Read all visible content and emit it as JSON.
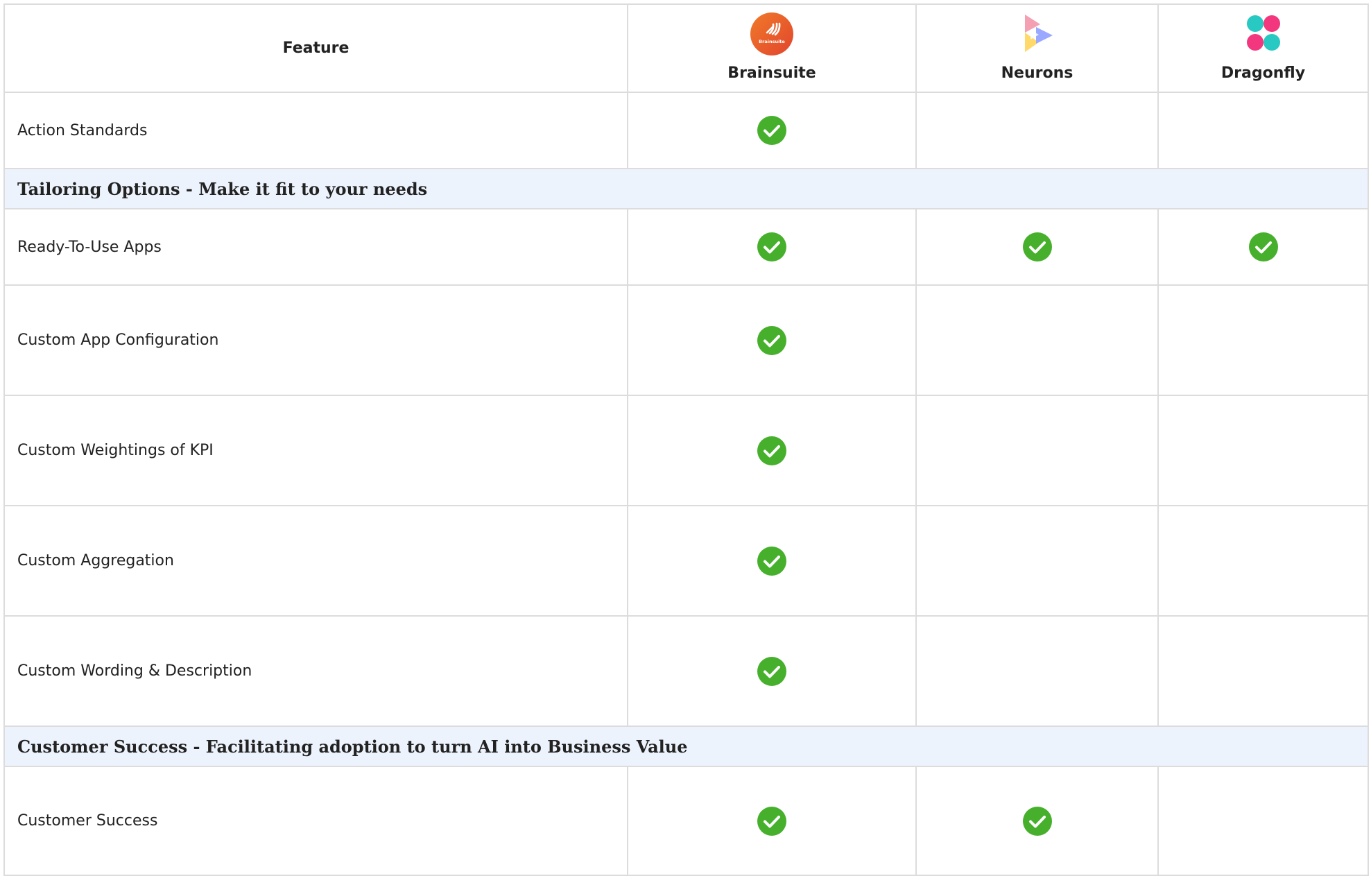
{
  "header": {
    "feature_label": "Feature",
    "vendors": [
      {
        "name": "Brainsuite",
        "logo_icon": "brainsuite-logo-icon",
        "logo_text": "Brainsuite"
      },
      {
        "name": "Neurons",
        "logo_icon": "neurons-logo-icon"
      },
      {
        "name": "Dragonfly",
        "logo_icon": "dragonfly-logo-icon"
      }
    ]
  },
  "rows": [
    {
      "type": "feature",
      "label": "Action Standards",
      "checks": [
        true,
        false,
        false
      ]
    },
    {
      "type": "section",
      "label": "Tailoring Options - Make it fit to your needs"
    },
    {
      "type": "feature",
      "label": "Ready-To-Use Apps",
      "checks": [
        true,
        true,
        true
      ]
    },
    {
      "type": "feature",
      "label": "Custom App Configuration",
      "checks": [
        true,
        false,
        false
      ]
    },
    {
      "type": "feature",
      "label": "Custom Weightings of KPI",
      "checks": [
        true,
        false,
        false
      ]
    },
    {
      "type": "feature",
      "label": "Custom Aggregation",
      "checks": [
        true,
        false,
        false
      ]
    },
    {
      "type": "feature",
      "label": "Custom Wording & Description",
      "checks": [
        true,
        false,
        false
      ]
    },
    {
      "type": "section",
      "label": "Customer Success - Facilitating adoption to turn AI into Business Value"
    },
    {
      "type": "feature",
      "label": "Customer Success",
      "checks": [
        true,
        true,
        false
      ]
    }
  ],
  "colors": {
    "check_green": "#46b02c",
    "section_bg": "#edf3fd",
    "border": "#dcdcdc",
    "brainsuite_orange": "#ea5a2a"
  }
}
